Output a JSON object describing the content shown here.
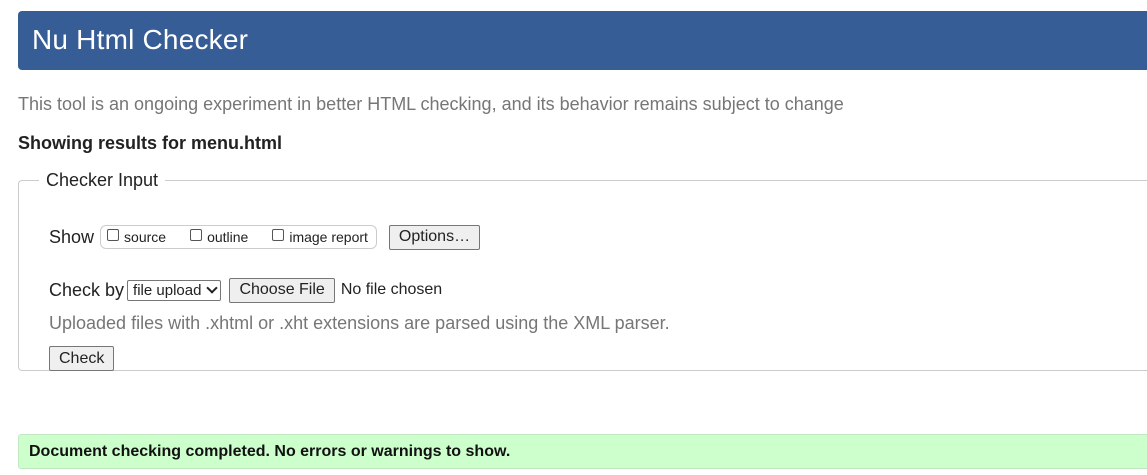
{
  "header": {
    "title": "Nu Html Checker",
    "background_color": "#365d95"
  },
  "subtitle": "This tool is an ongoing experiment in better HTML checking, and its behavior remains subject to change",
  "results_heading": "Showing results for menu.html",
  "checker_input": {
    "legend": "Checker Input",
    "show": {
      "label": "Show",
      "options": [
        {
          "label": "source",
          "checked": false
        },
        {
          "label": "outline",
          "checked": false
        },
        {
          "label": "image report",
          "checked": false
        }
      ],
      "options_button": "Options…"
    },
    "check_by": {
      "label": "Check by",
      "selected": "file upload",
      "choose_file_button": "Choose File",
      "file_status": "No file chosen"
    },
    "note": "Uploaded files with .xhtml or .xht extensions are parsed using the XML parser.",
    "check_button": "Check"
  },
  "status": {
    "message": "Document checking completed. No errors or warnings to show.",
    "background_color": "#ccffcc"
  }
}
